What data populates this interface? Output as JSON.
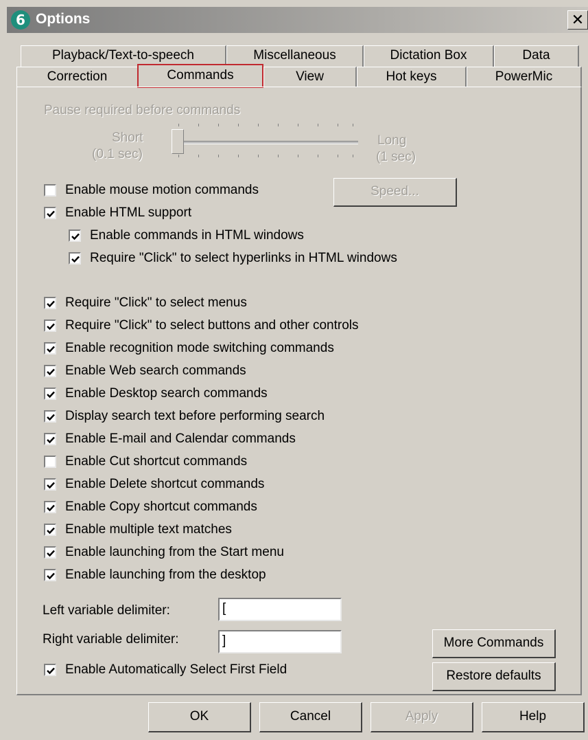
{
  "window": {
    "title": "Options",
    "logo_glyph": "6",
    "close_glyph": "✕"
  },
  "tabs": {
    "row1": [
      "Playback/Text-to-speech",
      "Miscellaneous",
      "Dictation Box",
      "Data"
    ],
    "row2": [
      "Correction",
      "Commands",
      "View",
      "Hot keys",
      "PowerMic"
    ],
    "active": "Commands"
  },
  "pause": {
    "label": "Pause required before commands",
    "short_label": "Short",
    "short_value": "(0.1 sec)",
    "long_label": "Long",
    "long_value": "(1 sec)",
    "slider_position_fraction": 0.0
  },
  "speed_button": "Speed...",
  "options": [
    {
      "label": "Enable mouse motion commands",
      "checked": false
    },
    {
      "label": "Enable HTML support",
      "checked": true
    },
    {
      "label": "Enable commands in HTML windows",
      "checked": true
    },
    {
      "label": "Require \"Click\" to select hyperlinks in HTML windows",
      "checked": true
    },
    {
      "label": "Require \"Click\" to select menus",
      "checked": true
    },
    {
      "label": "Require \"Click\" to select buttons and other controls",
      "checked": true
    },
    {
      "label": "Enable recognition mode switching commands",
      "checked": true
    },
    {
      "label": "Enable Web search commands",
      "checked": true
    },
    {
      "label": "Enable Desktop search commands",
      "checked": true
    },
    {
      "label": "Display search text before performing search",
      "checked": true
    },
    {
      "label": "Enable E-mail and Calendar commands",
      "checked": true
    },
    {
      "label": "Enable Cut shortcut commands",
      "checked": false
    },
    {
      "label": "Enable Delete shortcut commands",
      "checked": true
    },
    {
      "label": "Enable Copy shortcut commands",
      "checked": true
    },
    {
      "label": "Enable multiple text matches",
      "checked": true
    },
    {
      "label": "Enable launching from the Start menu",
      "checked": true
    },
    {
      "label": "Enable launching from the desktop",
      "checked": true
    },
    {
      "label": "Enable Automatically Select First Field",
      "checked": true
    }
  ],
  "delimiters": {
    "left_label": "Left variable delimiter:",
    "left_value": "[",
    "right_label": "Right variable delimiter:",
    "right_value": "]"
  },
  "side_buttons": {
    "more_commands": "More Commands",
    "restore_defaults": "Restore defaults"
  },
  "footer": {
    "ok": "OK",
    "cancel": "Cancel",
    "apply": "Apply",
    "help": "Help"
  },
  "colors": {
    "dialog_bg": "#d4d0c8",
    "active_tab_outline": "#c0292f",
    "disabled_text": "#a3a09a"
  }
}
